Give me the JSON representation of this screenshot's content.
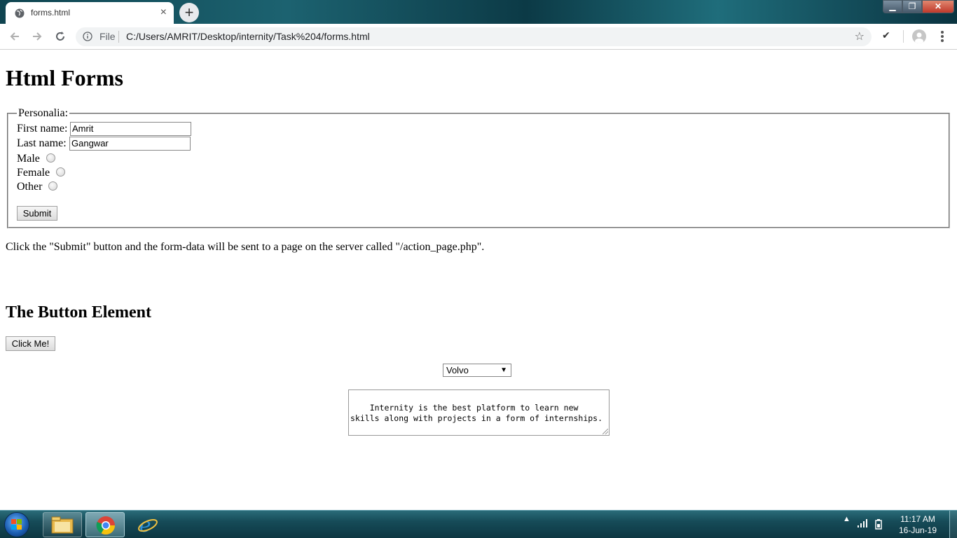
{
  "browser": {
    "tab_title": "forms.html",
    "tab_close": "×",
    "new_tab": "+",
    "address_file_label": "File",
    "address_url": "C:/Users/AMRIT/Desktop/internity/Task%204/forms.html",
    "bookmark_star": "☆",
    "extension_check": "✔",
    "window_controls": {
      "close": "✕",
      "restore": "❐",
      "minimize": "▁"
    }
  },
  "page": {
    "heading": "Html Forms",
    "fieldset_legend": "Personalia:",
    "first_name_label": "First name:",
    "first_name_value": "Amrit",
    "last_name_label": "Last name:",
    "last_name_value": "Gangwar",
    "radio_male": "Male",
    "radio_female": "Female",
    "radio_other": "Other",
    "submit_label": "Submit",
    "info_text": "Click the \"Submit\" button and the form-data will be sent to a page on the server called \"/action_page.php\".",
    "section_heading": "The Button Element",
    "click_button_label": "Click Me!",
    "select_value": "Volvo",
    "select_arrow": "▼",
    "textarea_value": "Internity is the best platform to learn new skills along with projects in a form of internships."
  },
  "taskbar": {
    "time": "11:17 AM",
    "date": "16-Jun-19",
    "tray_arrow": "▲"
  }
}
